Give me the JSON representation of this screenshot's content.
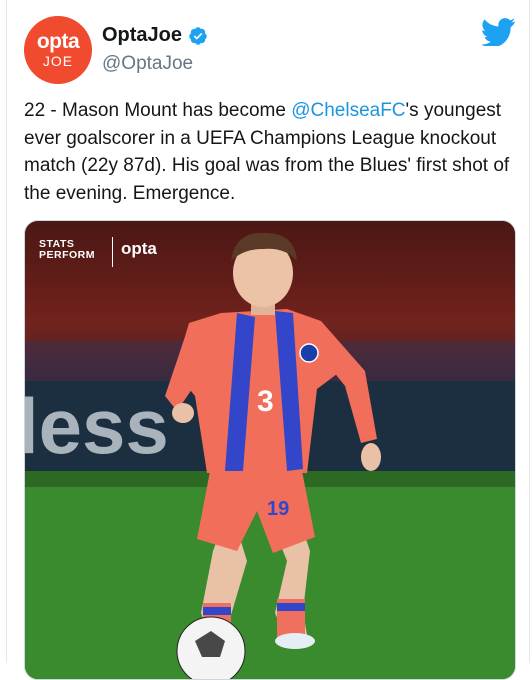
{
  "account": {
    "avatar_line1": "opta",
    "avatar_line2": "JOE",
    "display_name": "OptaJoe",
    "handle": "@OptaJoe"
  },
  "tweet": {
    "text_before": "22 - Mason Mount has become ",
    "mention": "@ChelseaFC",
    "text_after": "'s youngest ever goalscorer in a UEFA Champions League knockout match (22y 87d). His goal was from the Blues' first shot of the evening. Emergence."
  },
  "media": {
    "logo_stats_line1": "STATS",
    "logo_stats_line2": "PERFORM",
    "logo_opta": "opta",
    "shirt_number": "19",
    "board_text": "less"
  },
  "icons": {
    "verified": "verified-badge-icon",
    "bird": "twitter-bird-icon"
  },
  "colors": {
    "brand_blue": "#1da1f2",
    "mention_blue": "#1b95e0",
    "avatar_bg": "#f04a2f",
    "kit_coral": "#f06e5a",
    "kit_blue": "#3346c9"
  }
}
